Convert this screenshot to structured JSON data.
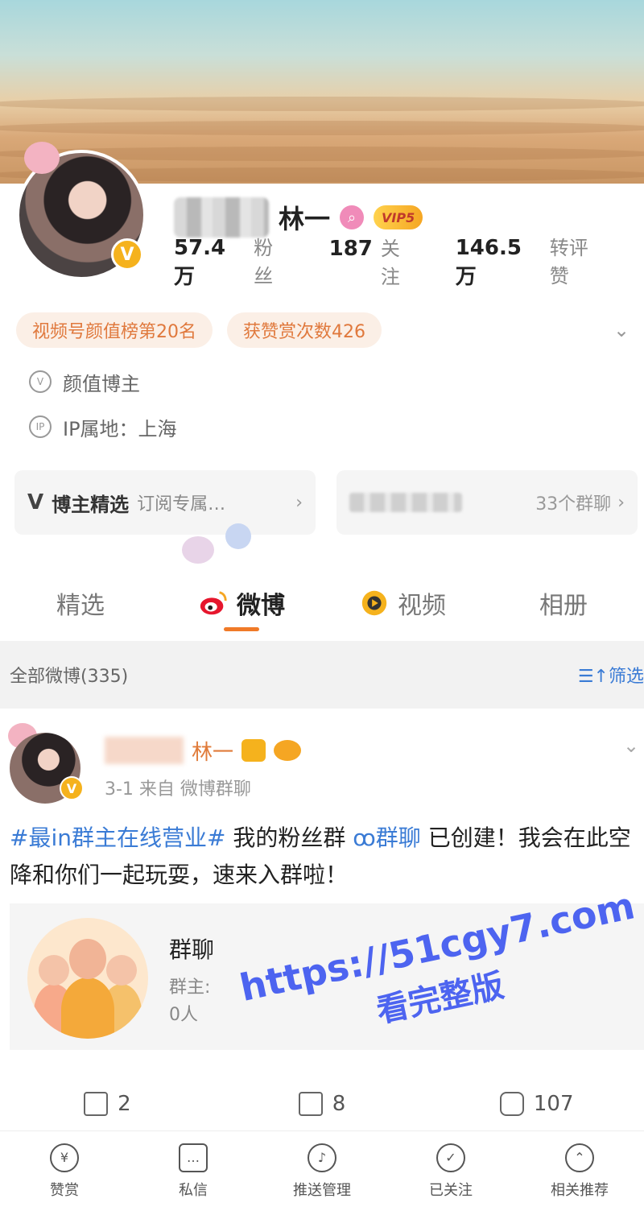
{
  "profile": {
    "name_suffix": "林一",
    "vip_label": "VIP5",
    "stats": [
      {
        "num": "57.4万",
        "label": "粉丝"
      },
      {
        "num": "187",
        "label": "关注"
      },
      {
        "num": "146.5万",
        "label": "转评赞"
      }
    ],
    "tags": [
      "视频号颜值榜第20名",
      "获赞赏次数426"
    ],
    "category": "颜值博主",
    "ip_location": "IP属地：上海"
  },
  "cards": {
    "featured_title": "博主精选",
    "featured_sub": "订阅专属…",
    "group_count": "33个群聊"
  },
  "tabs": [
    "精选",
    "微博",
    "视频",
    "相册"
  ],
  "feed": {
    "header": "全部微博(335)",
    "filter": "筛选"
  },
  "post": {
    "name_suffix": "林一",
    "meta": "3-1  来自 微博群聊",
    "hashtag": "#最in群主在线营业#",
    "text1": " 我的粉丝群 ",
    "group_link": "群聊",
    "text2": " 已创建！我会在此空降和你们一起玩耍，速来入群啦！",
    "group_card": {
      "title": "群聊",
      "owner": "群主:",
      "count": "0人"
    },
    "actions": {
      "repost": "2",
      "comment": "8",
      "like": "107"
    }
  },
  "watermark": {
    "line1": "https://51cgy7.com",
    "line2": "看完整版"
  },
  "bottom_nav": [
    "赞赏",
    "私信",
    "推送管理",
    "已关注",
    "相关推荐"
  ],
  "colors": {
    "accent": "#f07a28",
    "link": "#3a7bd5",
    "tag_text": "#e0793d",
    "watermark": "#4d64f0"
  }
}
